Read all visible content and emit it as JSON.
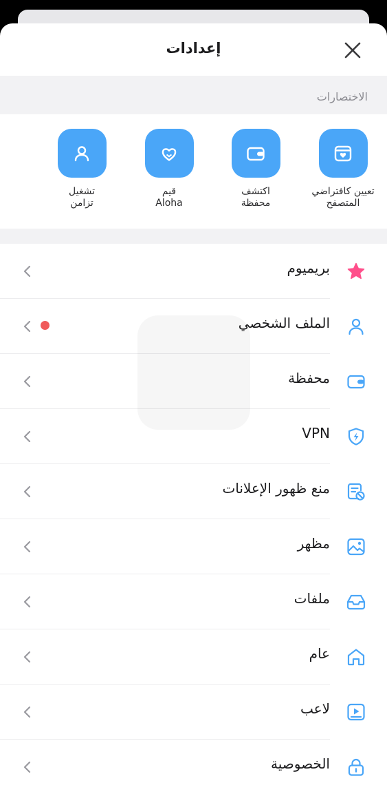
{
  "header": {
    "title": "إعدادات"
  },
  "shortcuts_section": {
    "title": "الاختصارات"
  },
  "shortcuts": [
    {
      "line1": "تعيين كافتراضي",
      "line2": "المتصفح",
      "icon": "browser-heart-icon"
    },
    {
      "line1": "اكتشف",
      "line2": "محفظة",
      "icon": "wallet-icon"
    },
    {
      "line1": "قيم",
      "line2": "Aloha",
      "icon": "heart-icon"
    },
    {
      "line1": "تشغيل",
      "line2": "تزامن",
      "icon": "user-icon"
    }
  ],
  "menu": [
    {
      "label": "بريميوم",
      "icon": "star-icon"
    },
    {
      "label": "الملف الشخصي",
      "icon": "user-icon",
      "badge": true
    },
    {
      "label": "محفظة",
      "icon": "wallet-icon"
    },
    {
      "label": "VPN",
      "icon": "shield-bolt-icon"
    },
    {
      "label": "منع ظهور الإعلانات",
      "icon": "adblock-icon"
    },
    {
      "label": "مظهر",
      "icon": "image-icon"
    },
    {
      "label": "ملفات",
      "icon": "inbox-icon"
    },
    {
      "label": "عام",
      "icon": "home-icon"
    },
    {
      "label": "لاعب",
      "icon": "player-icon"
    },
    {
      "label": "الخصوصية",
      "icon": "lock-icon"
    }
  ],
  "colors": {
    "accent": "#4aa6f8",
    "premium": "#ff4f8b",
    "badge": "#f05a5a",
    "chevron": "#9a9aa0"
  }
}
